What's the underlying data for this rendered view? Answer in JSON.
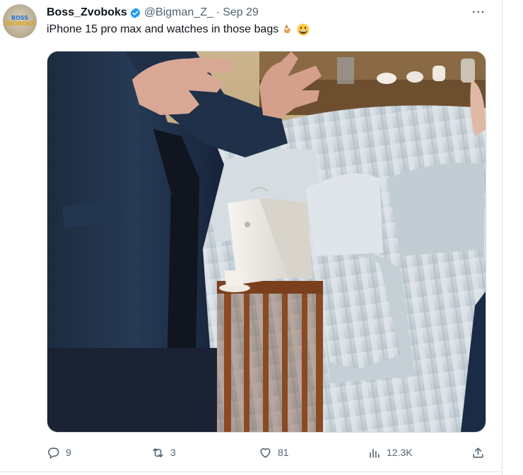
{
  "author": {
    "display_name": "Boss_Zvoboks",
    "handle": "@Bigman_Z_",
    "separator": "·",
    "date": "Sep 29",
    "verified": true,
    "avatar_text_line1": "BOSS",
    "avatar_text_line2": "ZVOBOKS"
  },
  "tweet": {
    "text": "iPhone 15 pro max and watches in those bags",
    "emojis": [
      "ok-hand-emoji",
      "grinning-face-emoji"
    ]
  },
  "more_label": "···",
  "actions": {
    "replies": "9",
    "retweets": "3",
    "likes": "81",
    "views": "12.3K"
  },
  "colors": {
    "text": "#0f1419",
    "muted": "#536471",
    "verified": "#1d9bf0"
  }
}
